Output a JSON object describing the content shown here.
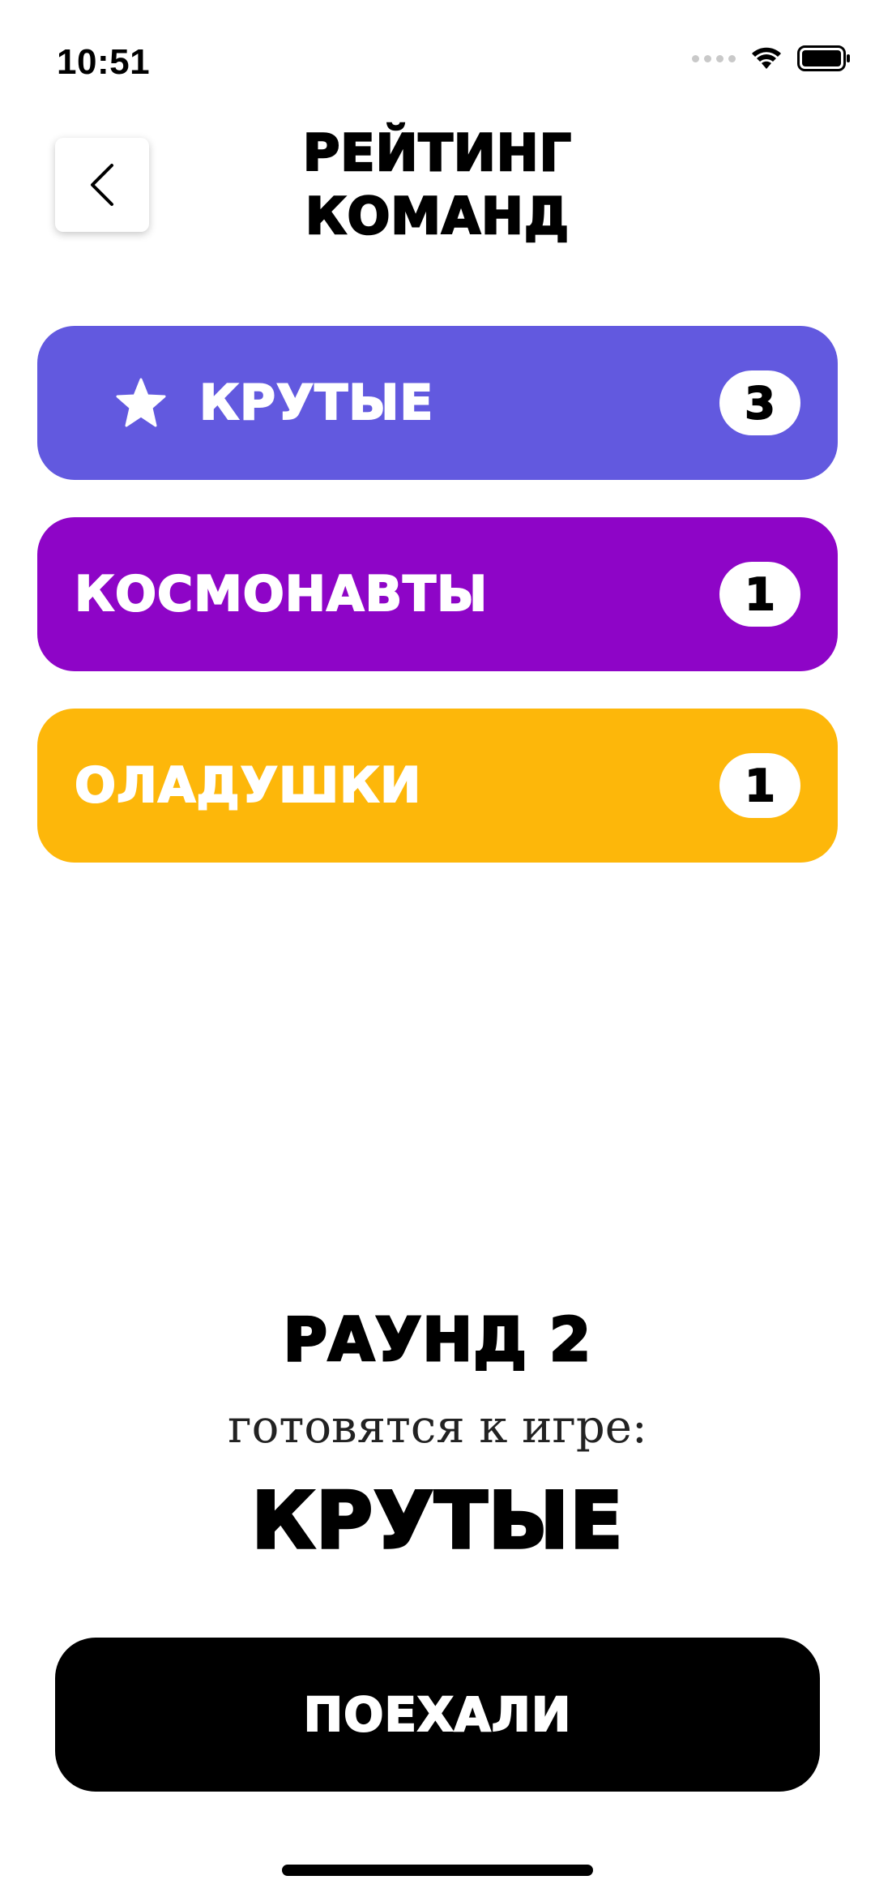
{
  "status_bar": {
    "time": "10:51"
  },
  "header": {
    "title_line1": "РЕЙТИНГ",
    "title_line2": "КОМАНД",
    "back_icon": "chevron-left-icon"
  },
  "teams": [
    {
      "name": "КРУТЫЕ",
      "score": "3",
      "color": "#6259DF",
      "active": true,
      "icon": "star-icon"
    },
    {
      "name": "КОСМОНАВТЫ",
      "score": "1",
      "color": "#8E05C7",
      "active": false
    },
    {
      "name": "ОЛАДУШКИ",
      "score": "1",
      "color": "#FDB70A",
      "active": false
    }
  ],
  "round": {
    "title": "РАУНД 2",
    "subtitle": "готовятся к игре:",
    "current_team": "КРУТЫЕ"
  },
  "action": {
    "go_label": "ПОЕХАЛИ"
  }
}
